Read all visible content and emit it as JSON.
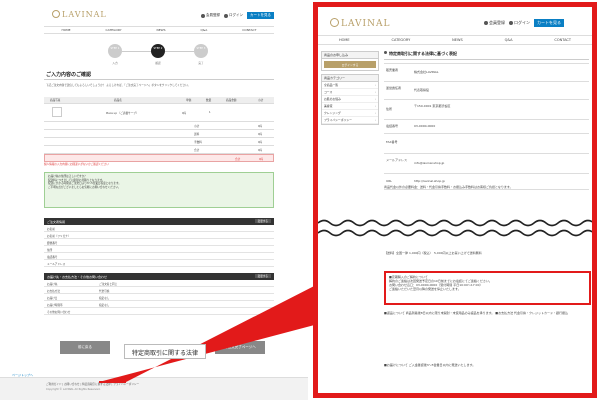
{
  "site": {
    "logo": "LAVINAL",
    "header_links": {
      "member": "会員登録",
      "login": "ログイン",
      "cart": "カートを見る"
    },
    "nav": [
      "HOME",
      "CATEGORY",
      "NEWS",
      "Q&A",
      "CONTACT"
    ]
  },
  "left": {
    "steps": [
      {
        "num": "STEP 1",
        "label": "入力"
      },
      {
        "num": "STEP 2",
        "label": "確認"
      },
      {
        "num": "STEP 3",
        "label": "完了"
      }
    ],
    "section_title": "ご入力内容のご確認",
    "note": "下記ご注文内容で送信してもよろしいでしょうか？ よろしければ、「ご注文完了ページへ」ボタンをクリックしてください。",
    "table": {
      "headers": [
        "商品写真",
        "商品名",
        "単価",
        "数量",
        "商品金額",
        "小計"
      ],
      "product_name": "Piece up （ご請書サーブ）",
      "unit_price": "0円",
      "qty": "1",
      "rows": [
        {
          "label": "小計",
          "value": "0円"
        },
        {
          "label": "送料",
          "value": "0円"
        },
        {
          "label": "手数料",
          "value": "0円"
        },
        {
          "label": "合計",
          "value": "0円"
        }
      ],
      "total_label": "合計",
      "total_value": "0円"
    },
    "warning": "個人情報の入力内容にお間違いがないかご確認ください",
    "green_notes": [
      "お届け先の住所は正しいですか？",
      "配送料につきましては別途お見積りとなります。",
      "配送にかかる時間はご注文日より3〜5営業日程度となります。",
      "ご不明な点がございましたらお気軽にお問い合わせください。"
    ],
    "customer_section": {
      "title": "ご注文者情報",
      "edit": "変更する",
      "rows": [
        {
          "k": "お名前",
          "v": ""
        },
        {
          "k": "お名前（フリガナ）",
          "v": ""
        },
        {
          "k": "郵便番号",
          "v": ""
        },
        {
          "k": "住所",
          "v": ""
        },
        {
          "k": "電話番号",
          "v": ""
        },
        {
          "k": "メールアドレス",
          "v": ""
        }
      ]
    },
    "delivery_section": {
      "title": "お届け先・お支払方法・その他お問い合わせ",
      "edit": "変更する",
      "rows": [
        {
          "k": "お届け先",
          "v": "ご注文者と同じ"
        },
        {
          "k": "お支払方法",
          "v": "代金引換"
        },
        {
          "k": "お届け日",
          "v": "指定なし"
        },
        {
          "k": "お届け時間帯",
          "v": "指定なし"
        },
        {
          "k": "その他お問い合わせ",
          "v": ""
        }
      ]
    },
    "back_button": "前に戻る",
    "next_button": "ご注文完了ページへ",
    "pagetop": "ページトップへ",
    "footer_links": "ご利用ガイド | お問い合わせ | 特定商取引に関する法律 | プライバシーポリシー",
    "footer_copy": "Copyright © LAVINAL All Rights Reserved."
  },
  "callout": "特定商取引に関する法律",
  "right": {
    "sidebar": {
      "login_title": "商品のお申し込み",
      "gold_button": "ログインする",
      "search_title": "商品カテゴリー",
      "items": [
        "全商品一覧",
        "コース",
        "お肌のお悩み",
        "美容液",
        "クレンジング",
        "プライバシーポリシー"
      ]
    },
    "page_title": "特定商取引に関する法律に基づく表記",
    "info": [
      {
        "k": "販売業者",
        "v": "株式会社LAVINAL"
      },
      {
        "k": "運営責任者",
        "v": "代表取締役"
      },
      {
        "k": "住所",
        "v": "〒150-0001 東京都渋谷区"
      },
      {
        "k": "電話番号",
        "v": "03-0000-0000"
      },
      {
        "k": "FAX番号",
        "v": ""
      },
      {
        "k": "メールアドレス",
        "v": "info@lavinal.shop.jp"
      },
      {
        "k": "URL",
        "v": "http://lavinal.shop.jp"
      }
    ],
    "price_text": "商品代金以外の必要料金：送料・代金引換手数料・お振込み手数料はお客様ご負担となります。",
    "pre_box_text": "【送料】全国一律 1,000円（税込）　5,000円以上お買い上げで送料無料",
    "redbox": [
      "■定期購入のご解約について",
      "解約のご連絡は次回発送予定日の10日前までにお電話にてご連絡ください。",
      "お問い合わせ窓口：03-0000-0000（受付時間 平日10:00〜17:00）",
      "ご連絡いただいた翌月以降の発送を停止いたします。"
    ],
    "post_box_text": "■返品について 商品到着後8日以内に限り未開封・未使用品のみ返品を承ります。 ■お支払方法 代金引換・クレジットカード・銀行振込",
    "post_box_text2": "■お届けについて ご入金確認後3〜5営業日以内に発送いたします。"
  }
}
